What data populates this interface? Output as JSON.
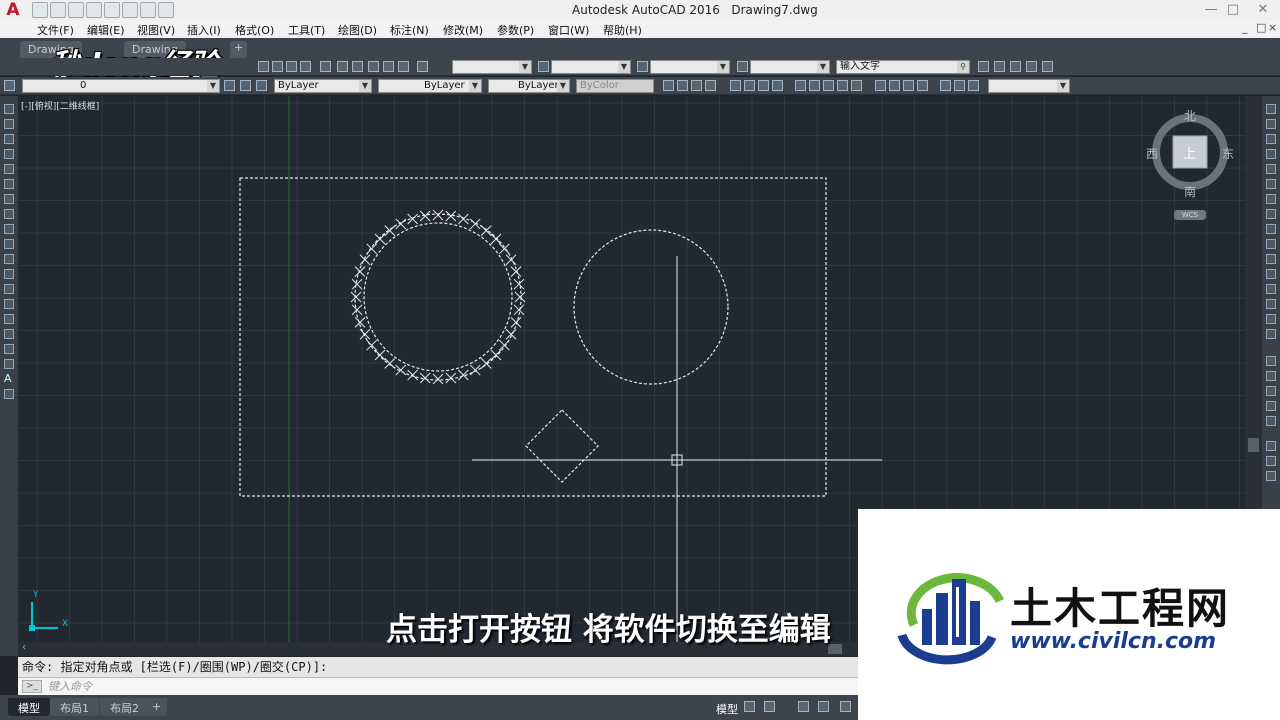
{
  "app": {
    "logo": "A",
    "title": "Autodesk AutoCAD 2016",
    "file": "Drawing7.dwg"
  },
  "menu": [
    "文件(F)",
    "编辑(E)",
    "视图(V)",
    "插入(I)",
    "格式(O)",
    "工具(T)",
    "绘图(D)",
    "标注(N)",
    "修改(M)",
    "参数(P)",
    "窗口(W)",
    "帮助(H)"
  ],
  "tabs": [
    "Drawing",
    "Drawing"
  ],
  "toolbar": {
    "layer_value": "0",
    "color": "ByLayer",
    "linetype": "ByLayer",
    "lineweight": "ByLayer",
    "plotstyle": "ByColor",
    "search_placeholder": "输入文字"
  },
  "viewport": {
    "label": "[-][俯视][二维线框]",
    "compass": {
      "n": "北",
      "s": "南",
      "e": "东",
      "w": "西",
      "top": "上",
      "wcs": "WCS"
    },
    "ucs": {
      "x": "X",
      "y": "Y"
    }
  },
  "command": {
    "history": "命令: 指定对角点或 [栏选(F)/圈围(WP)/圈交(CP)]:",
    "placeholder": "键入命令"
  },
  "layouts": [
    "模型",
    "布局1",
    "布局2"
  ],
  "status": {
    "model": "模型"
  },
  "overlay": {
    "watermark": "秒dong经验",
    "subtitle": "点击打开按钮 将软件切换至编辑",
    "brand_cn": "土木工程网",
    "brand_url": "www.civilcn.com"
  },
  "colors": {
    "canvas": "#212830",
    "grid": "#2f3945",
    "ucs": "#00c8d0",
    "brand_blue": "#1b3d8f",
    "brand_green": "#6cb83c"
  }
}
